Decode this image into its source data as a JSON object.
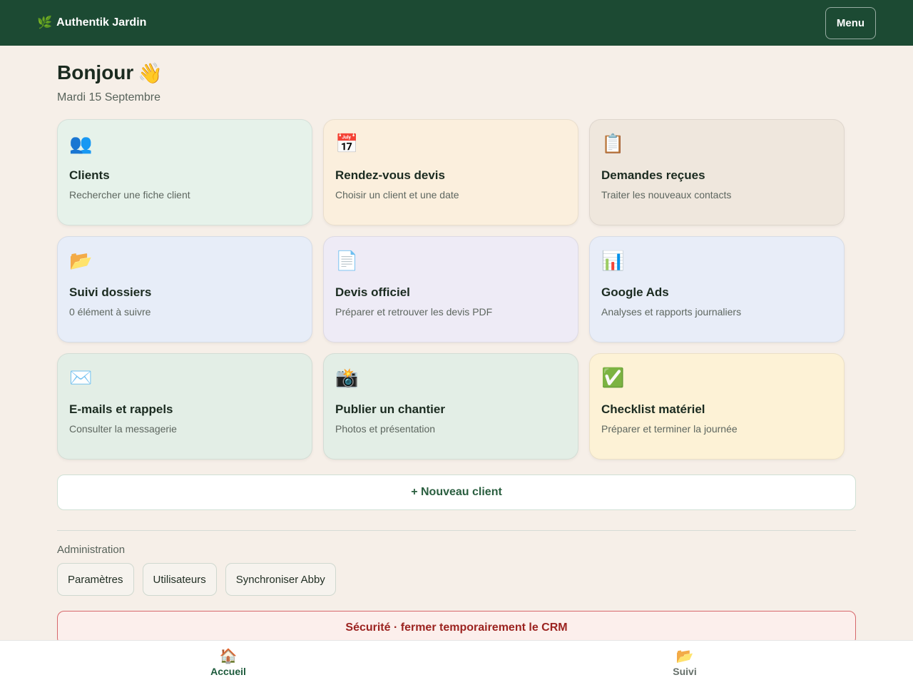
{
  "header": {
    "brand_icon": "🌿",
    "brand_name": "Authentik Jardin",
    "menu_label": "Menu"
  },
  "greeting": {
    "title": "Bonjour",
    "emoji": "👋",
    "date": "Mardi 15 Septembre"
  },
  "cards": [
    {
      "icon": "👥",
      "icon_name": "people-icon",
      "title": "Clients",
      "subtitle": "Rechercher une fiche client",
      "bg": "#e6f2ea"
    },
    {
      "icon": "📅",
      "icon_name": "calendar-icon",
      "title": "Rendez-vous devis",
      "subtitle": "Choisir un client et une date",
      "bg": "#fbefdd"
    },
    {
      "icon": "📋",
      "icon_name": "clipboard-icon",
      "title": "Demandes reçues",
      "subtitle": "Traiter les nouveaux contacts",
      "bg": "#efe7dd"
    },
    {
      "icon": "📂",
      "icon_name": "open-folder-icon",
      "title": "Suivi dossiers",
      "subtitle": "0 élément à suivre",
      "bg": "#e7edf8"
    },
    {
      "icon": "📄",
      "icon_name": "document-icon",
      "title": "Devis officiel",
      "subtitle": "Préparer et retrouver les devis PDF",
      "bg": "#eeebf6"
    },
    {
      "icon": "📊",
      "icon_name": "bar-chart-icon",
      "title": "Google Ads",
      "subtitle": "Analyses et rapports journaliers",
      "bg": "#e8edf8"
    },
    {
      "icon": "✉️",
      "icon_name": "envelope-icon",
      "title": "E-mails et rappels",
      "subtitle": "Consulter la messagerie",
      "bg": "#e3eee6"
    },
    {
      "icon": "📸",
      "icon_name": "camera-flash-icon",
      "title": "Publier un chantier",
      "subtitle": "Photos et présentation",
      "bg": "#e3eee6"
    },
    {
      "icon": "✅",
      "icon_name": "check-mark-icon",
      "title": "Checklist matériel",
      "subtitle": "Préparer et terminer la journée",
      "bg": "#fdf2d6"
    }
  ],
  "new_client_label": "+ Nouveau client",
  "admin": {
    "label": "Administration",
    "buttons": [
      "Paramètres",
      "Utilisateurs",
      "Synchroniser Abby"
    ]
  },
  "security_label": "Sécurité · fermer temporairement le CRM",
  "bottom_nav": {
    "home": {
      "icon": "🏠",
      "label": "Accueil"
    },
    "tracking": {
      "icon": "📂",
      "label": "Suivi"
    }
  },
  "colors": {
    "header_bg": "#1c4a33",
    "page_bg": "#f6efe8",
    "accent_green": "#2a5e3f",
    "danger_red": "#9b2320"
  }
}
